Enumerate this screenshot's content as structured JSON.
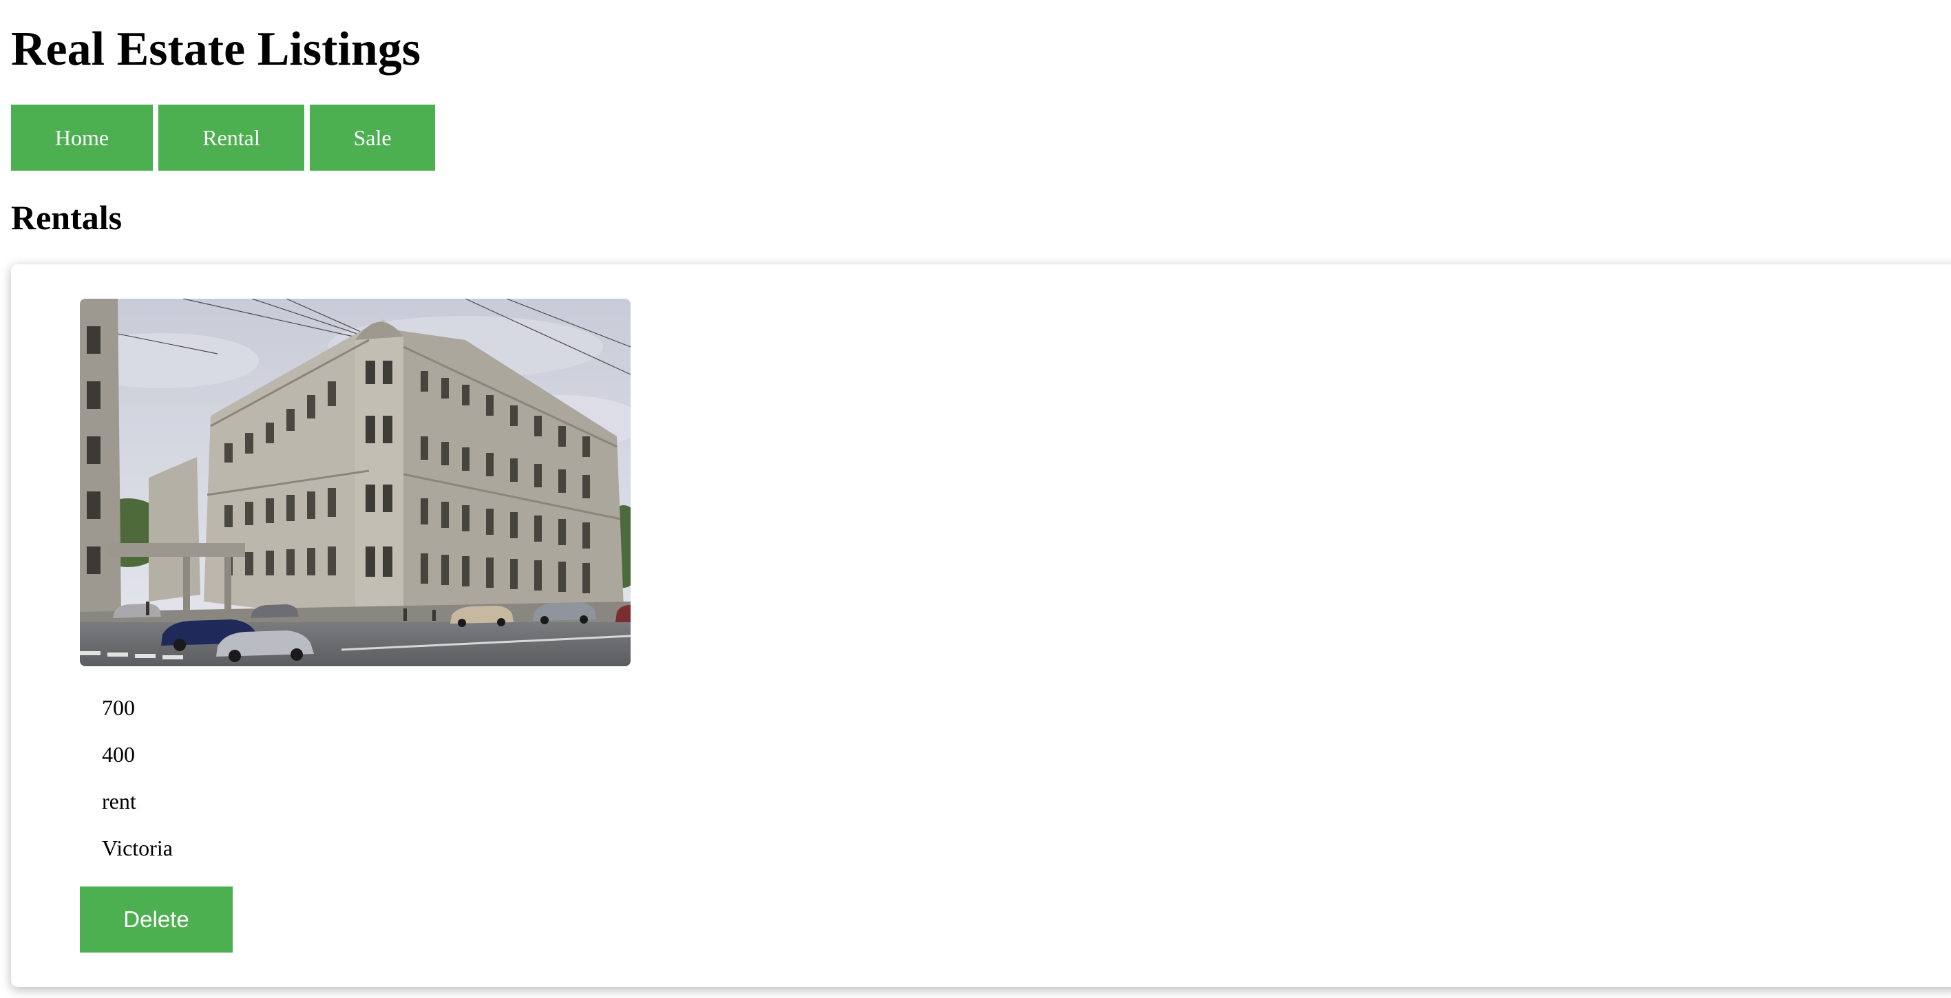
{
  "header": {
    "title": "Real Estate Listings"
  },
  "nav": {
    "items": [
      {
        "label": "Home"
      },
      {
        "label": "Rental"
      },
      {
        "label": "Sale"
      }
    ],
    "accent_color": "#4caf50"
  },
  "section": {
    "title": "Rentals"
  },
  "listing": {
    "image_icon": "building-photo",
    "fields": [
      "700",
      "400",
      "rent",
      "Victoria"
    ],
    "delete_label": "Delete"
  }
}
